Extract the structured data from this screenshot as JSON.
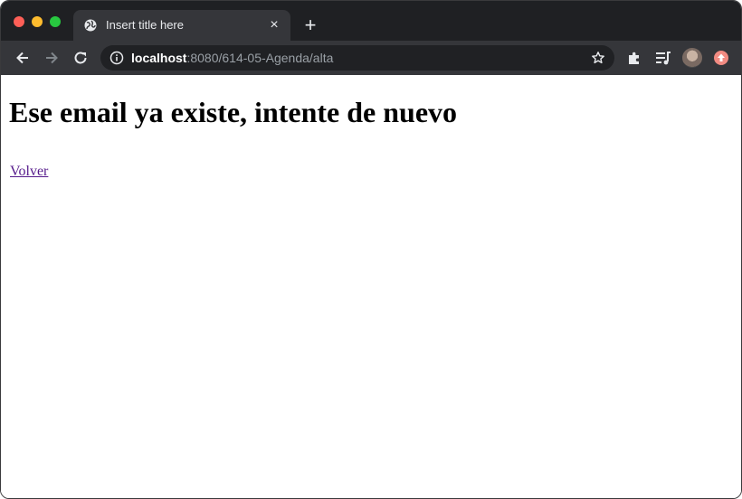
{
  "browser": {
    "tab": {
      "title": "Insert title here",
      "favicon": "globe-icon",
      "close": "×"
    },
    "new_tab": "+",
    "address": {
      "host": "localhost",
      "path": ":8080/614-05-Agenda/alta"
    },
    "colors": {
      "frame": "#1f2023",
      "toolbar": "#35363a",
      "omnibox": "#202124",
      "badge": "#f28b82"
    }
  },
  "page": {
    "heading": "Ese email ya existe, intente de nuevo",
    "link": "Volver",
    "link_color": "#551a8b"
  }
}
